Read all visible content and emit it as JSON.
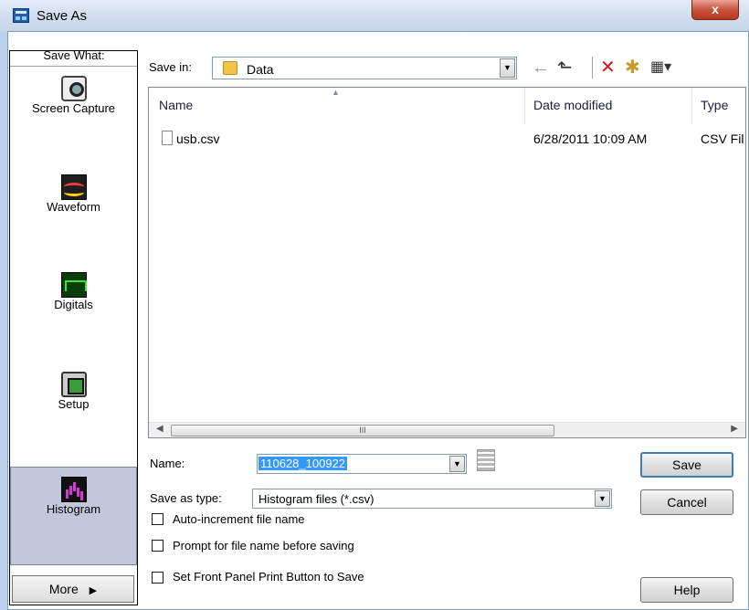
{
  "window": {
    "title": "Save As",
    "close_label": "x"
  },
  "sidebar": {
    "heading": "Save What:",
    "items": [
      {
        "label": "Screen Capture",
        "icon": "camera-icon"
      },
      {
        "label": "Waveform",
        "icon": "waveform-icon"
      },
      {
        "label": "Digitals",
        "icon": "digitals-icon"
      },
      {
        "label": "Setup",
        "icon": "setup-icon"
      },
      {
        "label": "Histogram",
        "icon": "histogram-icon",
        "selected": true
      }
    ],
    "more_label": "More",
    "more_arrow": "▶"
  },
  "save_in": {
    "label": "Save in:",
    "value": "Data",
    "dropdown_arrow": "▼"
  },
  "toolbar": {
    "back": "←",
    "up": "⬑",
    "delete": "✕",
    "new_folder": "✱",
    "views": "▦▾"
  },
  "file_list": {
    "columns": [
      "Name",
      "Date modified",
      "Type"
    ],
    "rows": [
      {
        "name": "usb.csv",
        "date": "6/28/2011 10:09 AM",
        "type": "CSV Fil"
      }
    ],
    "scroll_left": "◀",
    "scroll_right": "▶",
    "scroll_grip": "III"
  },
  "form": {
    "name_label": "Name:",
    "name_value": "110628_100922",
    "type_label": "Save as type:",
    "type_value": "Histogram files (*.csv)",
    "dropdown_arrow": "▼",
    "checkboxes": [
      {
        "label": "Auto-increment file name",
        "checked": false
      },
      {
        "label": "Prompt for file name before saving",
        "checked": false
      },
      {
        "label": "Set Front Panel Print Button to Save",
        "checked": false
      }
    ]
  },
  "buttons": {
    "save": "Save",
    "cancel": "Cancel",
    "help": "Help"
  },
  "colors": {
    "accent": "#3399ff",
    "selected_bg": "#c2c8dc",
    "frame": "#bcd2ea"
  }
}
